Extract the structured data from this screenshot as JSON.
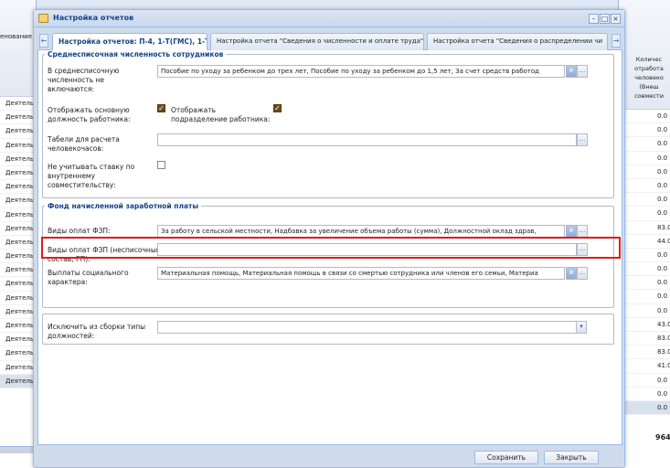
{
  "background": {
    "left_header": "енование",
    "left_rows": [
      "Деятель",
      "Деятель",
      "Деятель",
      "Деятель",
      "Деятель",
      "Деятель",
      "Деятель",
      "Деятель",
      "Деятель",
      "Деятель",
      "Деятель",
      "Деятель",
      "Деятель",
      "Деятель",
      "Деятель",
      "Деятель",
      "Деятель",
      "Деятель",
      "Деятель",
      "Деятель",
      "Деятель"
    ],
    "right_header": "Количес отработа человеко (Внеш совмести",
    "right_rows": [
      "0.0",
      "0.0",
      "0.0",
      "0.0",
      "0.0",
      "0.0",
      "0.0",
      "0.0",
      "83.0",
      "44.0",
      "0.0",
      "0.0",
      "0.0",
      "0.0",
      "0.0",
      "43.0",
      "83.0",
      "83.0",
      "41.0",
      "0.0",
      "0.0",
      "0.0"
    ],
    "right_total": "964"
  },
  "window": {
    "title": "Настройка отчетов",
    "tabs": [
      {
        "label": "Настройка отчетов: П-4, 1-Т(ГМС), 1-Т",
        "active": true
      },
      {
        "label": "Настройка отчета \"Сведения о численности и оплате труда\"",
        "active": false
      },
      {
        "label": "Настройка отчета \"Сведения о распределении чи",
        "active": false
      }
    ],
    "scroll_left": "←",
    "scroll_right": "→"
  },
  "section1": {
    "legend": "Среднесписочная численность сотрудников",
    "excluded_label": "В среднесписочную численность не включаются:",
    "excluded_value": "Пособие по уходу за ребенком до трех лет, Пособие по уходу за ребенком до 1,5 лет, За счет средств работод",
    "show_position_label": "Отображать основную должность работника:",
    "show_position_checked": true,
    "show_subdivision_label": "Отображать подразделение работника:",
    "show_subdivision_checked": true,
    "timesheets_label": "Табели для расчета человекочасов:",
    "timesheets_value": "",
    "ignore_rate_label": "Не учитывать ставку по внутреннему совместительству:",
    "ignore_rate_checked": false
  },
  "section2": {
    "legend": "Фонд начисленной заработной платы",
    "payments_label": "Виды оплат ФЗП:",
    "payments_value": "За работу в сельской местности, Надбавка за увеличение объема работы (сумма), Должностной оклад здрав,",
    "payments_listed_label": "Виды оплат ФЗП (несписочный состав, ГП):",
    "payments_listed_value": "",
    "social_label": "Выплаты социального характера:",
    "social_value": "Материальная помощь, Материальная помощь в связи со смертью сотрудника или членов его семьи, Материа"
  },
  "section3": {
    "exclude_types_label": "Исключить из сборки типы должностей:",
    "exclude_types_value": ""
  },
  "buttons": {
    "save": "Сохранить",
    "close": "Закрыть",
    "ellipsis": "...",
    "clear": "×",
    "dropdown": "▾",
    "check": "✓"
  },
  "icons": {
    "window_icon": "report-settings-icon",
    "minimize": "–",
    "restore": "□",
    "close": "×"
  },
  "colors": {
    "highlight": "#e11b1b",
    "accent": "#15428b",
    "panel_border": "#99bbe8"
  }
}
